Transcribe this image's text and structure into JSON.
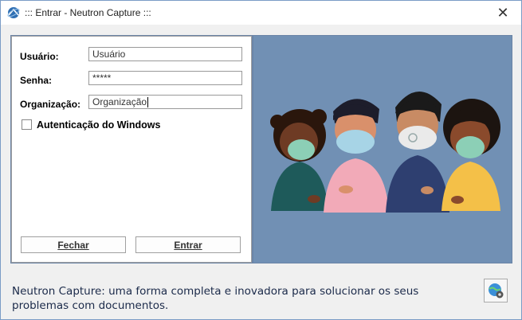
{
  "window": {
    "title": "::: Entrar - Neutron Capture :::",
    "app_icon": "app-logo-icon",
    "close_glyph": "✕"
  },
  "form": {
    "user_label": "Usuário:",
    "user_value": "Usuário",
    "password_label": "Senha:",
    "password_value": "*****",
    "organization_label": "Organização:",
    "organization_value": "Organização",
    "windows_auth_label": "Autenticação do Windows",
    "windows_auth_checked": false,
    "close_button": "Fechar",
    "enter_button": "Entrar"
  },
  "illustration": {
    "icon": "people-wearing-masks-illustration",
    "background": "#7190b4"
  },
  "footer": {
    "text": "Neutron Capture: uma forma completa e inovadora para solucionar os seus problemas com documentos.",
    "settings_icon": "globe-gear-icon"
  },
  "colors": {
    "panel": "#6b84a6",
    "footer_text": "#1b2a4a"
  }
}
